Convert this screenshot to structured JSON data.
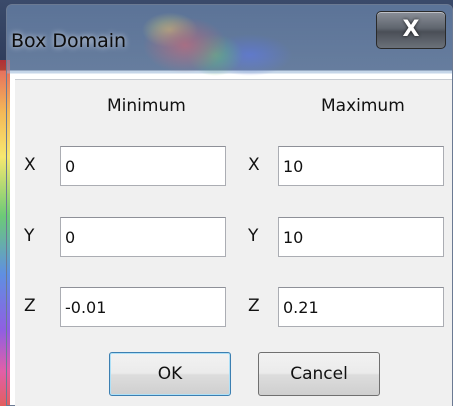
{
  "window": {
    "title": "Box Domain",
    "close_symbol": "X"
  },
  "columns": {
    "minimum_label": "Minimum",
    "maximum_label": "Maximum"
  },
  "minimum": {
    "x_label": "X",
    "x_value": "0",
    "y_label": "Y",
    "y_value": "0",
    "z_label": "Z",
    "z_value": "-0.01"
  },
  "maximum": {
    "x_label": "X",
    "x_value": "10",
    "y_label": "Y",
    "y_value": "10",
    "z_label": "Z",
    "z_value": "0.21"
  },
  "buttons": {
    "ok_label": "OK",
    "cancel_label": "Cancel"
  },
  "colors": {
    "titlebar": "#7d9bc4",
    "close_button": "#5f656e",
    "client_background": "#f0f0f0",
    "default_button_border": "#3c7fb1"
  }
}
